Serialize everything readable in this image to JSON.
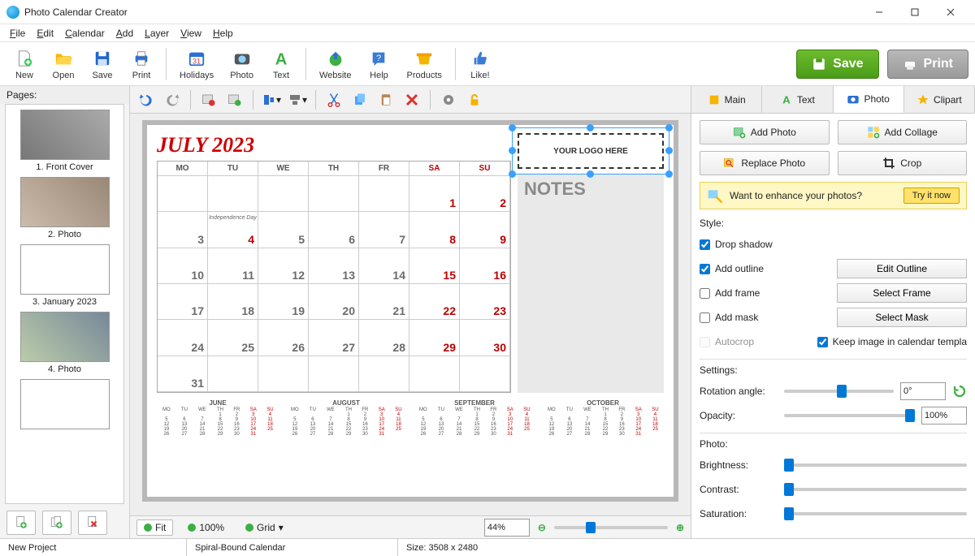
{
  "window": {
    "title": "Photo Calendar Creator"
  },
  "menus": [
    "File",
    "Edit",
    "Calendar",
    "Add",
    "Layer",
    "View",
    "Help"
  ],
  "toolbar": {
    "new": "New",
    "open": "Open",
    "save": "Save",
    "print": "Print",
    "holidays": "Holidays",
    "photo": "Photo",
    "text": "Text",
    "website": "Website",
    "help": "Help",
    "products": "Products",
    "like": "Like!",
    "save_btn": "Save",
    "print_btn": "Print"
  },
  "pages": {
    "header": "Pages:",
    "items": [
      {
        "label": "1. Front Cover"
      },
      {
        "label": "2. Photo"
      },
      {
        "label": "3. January 2023"
      },
      {
        "label": "4. Photo"
      }
    ]
  },
  "calendar": {
    "title": "JULY 2023",
    "dayHeaders": [
      "MO",
      "TU",
      "WE",
      "TH",
      "FR",
      "SA",
      "SU"
    ],
    "cells": [
      {
        "n": "",
        "dim": true
      },
      {
        "n": "",
        "dim": true
      },
      {
        "n": "",
        "dim": true
      },
      {
        "n": "",
        "dim": true
      },
      {
        "n": "",
        "dim": true
      },
      {
        "n": "1",
        "wk": true
      },
      {
        "n": "2",
        "wk": true
      },
      {
        "n": "3"
      },
      {
        "n": "4",
        "wk": true,
        "ev": "Independence Day"
      },
      {
        "n": "5"
      },
      {
        "n": "6"
      },
      {
        "n": "7"
      },
      {
        "n": "8",
        "wk": true
      },
      {
        "n": "9",
        "wk": true
      },
      {
        "n": "10"
      },
      {
        "n": "11"
      },
      {
        "n": "12"
      },
      {
        "n": "13"
      },
      {
        "n": "14"
      },
      {
        "n": "15",
        "wk": true
      },
      {
        "n": "16",
        "wk": true
      },
      {
        "n": "17"
      },
      {
        "n": "18"
      },
      {
        "n": "19"
      },
      {
        "n": "20"
      },
      {
        "n": "21"
      },
      {
        "n": "22",
        "wk": true
      },
      {
        "n": "23",
        "wk": true
      },
      {
        "n": "24"
      },
      {
        "n": "25"
      },
      {
        "n": "26"
      },
      {
        "n": "27"
      },
      {
        "n": "28"
      },
      {
        "n": "29",
        "wk": true
      },
      {
        "n": "30",
        "wk": true
      },
      {
        "n": "31"
      },
      {
        "n": "",
        "dim": true
      },
      {
        "n": "",
        "dim": true
      },
      {
        "n": "",
        "dim": true
      },
      {
        "n": "",
        "dim": true
      },
      {
        "n": "",
        "dim": true
      },
      {
        "n": "",
        "dim": true
      }
    ],
    "logo": "YOUR LOGO HERE",
    "notes": "NOTES",
    "minis": [
      "JUNE",
      "AUGUST",
      "SEPTEMBER",
      "OCTOBER"
    ]
  },
  "zoom": {
    "fit": "Fit",
    "hundred": "100%",
    "grid": "Grid",
    "percent": "44%"
  },
  "tabs": {
    "main": "Main",
    "text": "Text",
    "photo": "Photo",
    "clipart": "Clipart"
  },
  "rp": {
    "add_photo": "Add Photo",
    "add_collage": "Add Collage",
    "replace": "Replace Photo",
    "crop": "Crop",
    "promo": "Want to enhance your photos?",
    "try": "Try it now",
    "style": "Style:",
    "drop_shadow": "Drop shadow",
    "add_outline": "Add outline",
    "edit_outline": "Edit Outline",
    "add_frame": "Add frame",
    "select_frame": "Select Frame",
    "add_mask": "Add mask",
    "select_mask": "Select Mask",
    "autocrop": "Autocrop",
    "keep": "Keep image in calendar templa",
    "settings": "Settings:",
    "rotation": "Rotation angle:",
    "rot_val": "0°",
    "opacity": "Opacity:",
    "op_val": "100%",
    "photo": "Photo:",
    "brightness": "Brightness:",
    "contrast": "Contrast:",
    "saturation": "Saturation:"
  },
  "status": {
    "project": "New Project",
    "type": "Spiral-Bound Calendar",
    "size": "Size: 3508 x 2480"
  }
}
